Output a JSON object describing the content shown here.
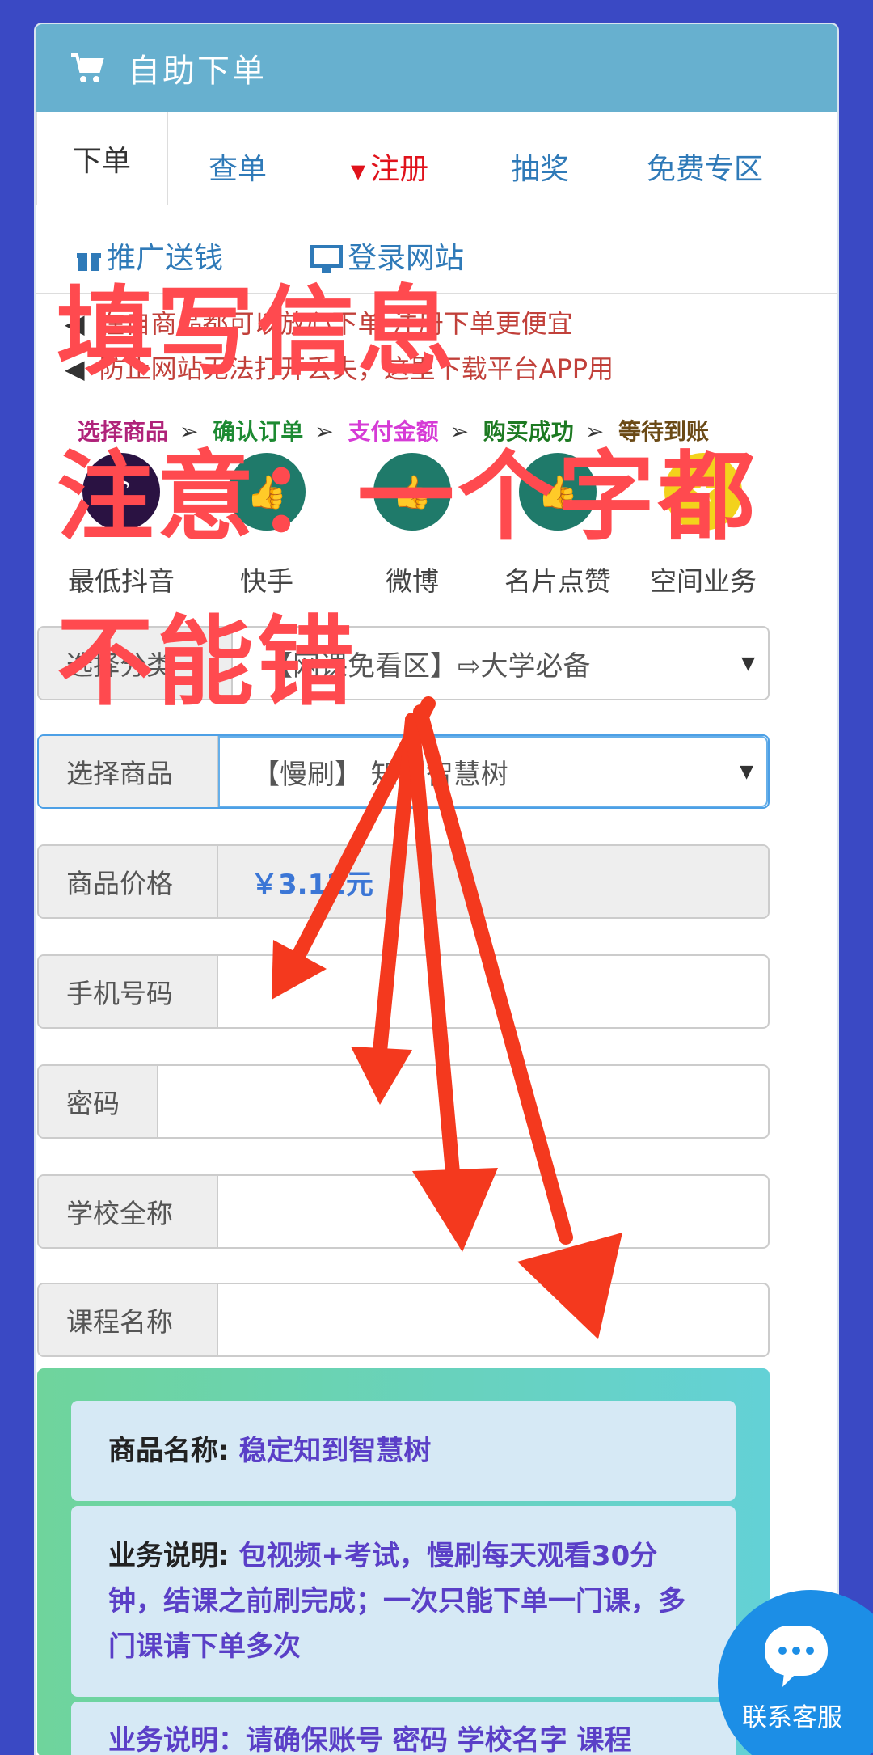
{
  "header": {
    "title": "自助下单"
  },
  "tabs": [
    {
      "label": "下单"
    },
    {
      "label": "查单"
    },
    {
      "label": "注册"
    },
    {
      "label": "抽奖"
    },
    {
      "label": "免费专区"
    },
    {
      "label": "推广送钱"
    },
    {
      "label": "登录网站"
    }
  ],
  "notice": {
    "line1": "在自商品都可以放心下单 注册下单更便宜",
    "line2": "防止网站无法打开丢失，这里下载平台APP用"
  },
  "steps": [
    "选择商品",
    "确认订单",
    "支付金额",
    "购买成功",
    "等待到账"
  ],
  "categories": [
    {
      "label": "最低抖音"
    },
    {
      "label": "快手"
    },
    {
      "label": "微博"
    },
    {
      "label": "名片点赞"
    },
    {
      "label": "空间业务"
    }
  ],
  "form": {
    "category": {
      "label": "选择分类",
      "value": "【网课免看区】⇨大学必备"
    },
    "product": {
      "label": "选择商品",
      "value": "【慢刷】 知到智慧树"
    },
    "price": {
      "label": "商品价格",
      "value": "￥3.12元"
    },
    "phone": {
      "label": "手机号码",
      "value": ""
    },
    "password": {
      "label": "密码",
      "value": ""
    },
    "school": {
      "label": "学校全称",
      "value": ""
    },
    "course": {
      "label": "课程名称",
      "value": ""
    }
  },
  "info": {
    "name_key": "商品名称",
    "name_val": "稳定知到智慧树",
    "desc_key": "业务说明",
    "desc_val": "包视频+考试，慢刷每天观看30分钟，结课之前刷完成；一次只能下单一门课，多门课请下单多次",
    "desc2_partial": "业务说明：请确保账号 密码 学校名字 课程"
  },
  "overlay": {
    "line1": "填写信息",
    "line2": "注意：一个字都",
    "line3": "不能错"
  },
  "support": {
    "label": "联系客服"
  },
  "colors": {
    "accent": "#67b0cf",
    "background": "#3a49c4",
    "annotation": "#ff4a4f"
  }
}
